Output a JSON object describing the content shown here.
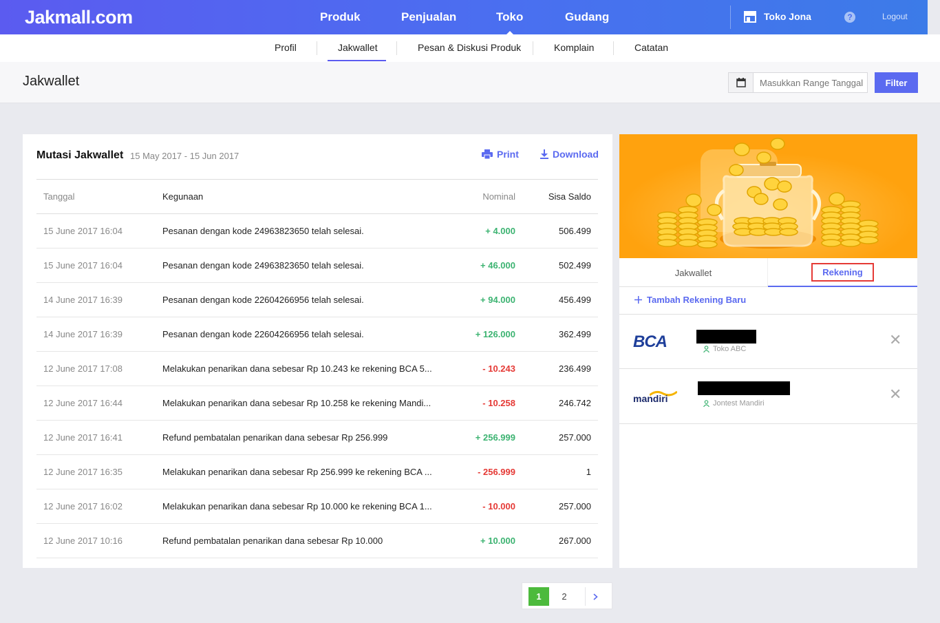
{
  "brand": "Jakmall.com",
  "main_nav": [
    "Produk",
    "Penjualan",
    "Toko",
    "Gudang"
  ],
  "store_name": "Toko Jona",
  "help": "?",
  "logout": "Logout",
  "sub_nav": [
    "Profil",
    "Jakwallet",
    "Pesan & Diskusi Produk",
    "Komplain",
    "Catatan"
  ],
  "page_title": "Jakwallet",
  "date_placeholder": "Masukkan Range Tanggal",
  "filter_label": "Filter",
  "mutasi": {
    "title": "Mutasi Jakwallet",
    "range": "15 May 2017 - 15 Jun 2017",
    "print": "Print",
    "download": "Download",
    "columns": [
      "Tanggal",
      "Kegunaan",
      "Nominal",
      "Sisa Saldo"
    ],
    "rows": [
      {
        "date": "15 June 2017 16:04",
        "desc": "Pesanan dengan kode 24963823650 telah selesai.",
        "nominal": "+ 4.000",
        "sign": "pos",
        "saldo": "506.499"
      },
      {
        "date": "15 June 2017 16:04",
        "desc": "Pesanan dengan kode 24963823650 telah selesai.",
        "nominal": "+ 46.000",
        "sign": "pos",
        "saldo": "502.499"
      },
      {
        "date": "14 June 2017 16:39",
        "desc": "Pesanan dengan kode 22604266956 telah selesai.",
        "nominal": "+ 94.000",
        "sign": "pos",
        "saldo": "456.499"
      },
      {
        "date": "14 June 2017 16:39",
        "desc": "Pesanan dengan kode 22604266956 telah selesai.",
        "nominal": "+ 126.000",
        "sign": "pos",
        "saldo": "362.499"
      },
      {
        "date": "12 June 2017 17:08",
        "desc": "Melakukan penarikan dana sebesar Rp 10.243 ke rekening BCA 5...",
        "nominal": "- 10.243",
        "sign": "neg",
        "saldo": "236.499"
      },
      {
        "date": "12 June 2017 16:44",
        "desc": "Melakukan penarikan dana sebesar Rp 10.258 ke rekening Mandi...",
        "nominal": "- 10.258",
        "sign": "neg",
        "saldo": "246.742"
      },
      {
        "date": "12 June 2017 16:41",
        "desc": "Refund pembatalan penarikan dana sebesar Rp 256.999",
        "nominal": "+ 256.999",
        "sign": "pos",
        "saldo": "257.000"
      },
      {
        "date": "12 June 2017 16:35",
        "desc": "Melakukan penarikan dana sebesar Rp 256.999 ke rekening BCA ...",
        "nominal": "- 256.999",
        "sign": "neg",
        "saldo": "1"
      },
      {
        "date": "12 June 2017 16:02",
        "desc": "Melakukan penarikan dana sebesar Rp 10.000 ke rekening BCA 1...",
        "nominal": "- 10.000",
        "sign": "neg",
        "saldo": "257.000"
      },
      {
        "date": "12 June 2017 10:16",
        "desc": "Refund pembatalan penarikan dana sebesar Rp 10.000",
        "nominal": "+ 10.000",
        "sign": "pos",
        "saldo": "267.000"
      }
    ]
  },
  "wallet": {
    "tabs": [
      "Jakwallet",
      "Rekening"
    ],
    "add_account": "Tambah Rekening Baru",
    "accounts": [
      {
        "bank": "BCA",
        "owner": "Toko ABC"
      },
      {
        "bank": "mandiri",
        "owner": "Jontest Mandiri"
      }
    ]
  },
  "pagination": [
    "1",
    "2"
  ],
  "colors": {
    "accent": "#5b6af0",
    "positive": "#3cb371",
    "negative": "#e53935",
    "banner": "#ffa20e",
    "page_active": "#4cba3c"
  }
}
